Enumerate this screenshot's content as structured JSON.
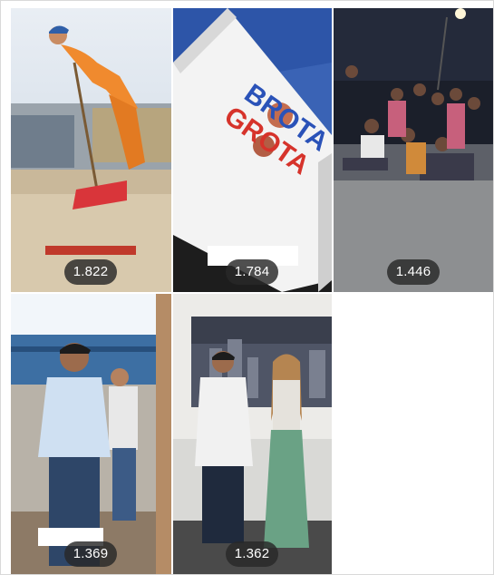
{
  "posts": [
    {
      "views": "1.822"
    },
    {
      "views": "1.784",
      "sign_text": "BROTA GROTA"
    },
    {
      "views": "1.446"
    },
    {
      "views": "1.369"
    },
    {
      "views": "1.362"
    }
  ],
  "colors": {
    "badge_bg": "#2b2b2b",
    "badge_text": "#ffffff",
    "sign_blue": "#2a52b8",
    "sign_yellow": "#f2b81c",
    "sign_red": "#d6332b",
    "orange_uniform": "#f08a2e"
  }
}
